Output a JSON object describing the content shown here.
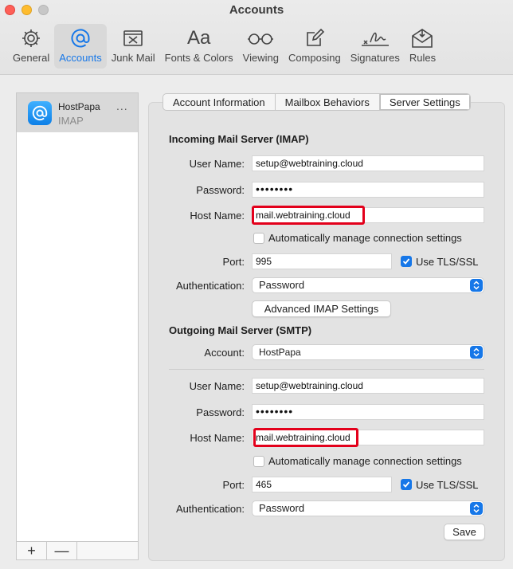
{
  "window": {
    "title": "Accounts"
  },
  "toolbar": {
    "items": [
      {
        "label": "General",
        "icon": "gear-icon"
      },
      {
        "label": "Accounts",
        "icon": "at-icon"
      },
      {
        "label": "Junk Mail",
        "icon": "junk-tray-icon"
      },
      {
        "label": "Fonts & Colors",
        "icon": "fonts-icon"
      },
      {
        "label": "Viewing",
        "icon": "glasses-icon"
      },
      {
        "label": "Composing",
        "icon": "compose-icon"
      },
      {
        "label": "Signatures",
        "icon": "signature-icon"
      },
      {
        "label": "Rules",
        "icon": "rules-envelope-icon"
      }
    ],
    "selected": "Accounts",
    "fonts_glyph": "Aa"
  },
  "accounts": {
    "items": [
      {
        "name": "HostPapa",
        "type": "IMAP",
        "more": "..."
      }
    ],
    "add_label": "+",
    "remove_label": "—"
  },
  "tabs": {
    "items": [
      "Account Information",
      "Mailbox Behaviors",
      "Server Settings"
    ],
    "selected": "Server Settings"
  },
  "incoming": {
    "title": "Incoming Mail Server (IMAP)",
    "username_label": "User Name:",
    "username": "setup@webtraining.cloud",
    "password_label": "Password:",
    "password": "••••••••",
    "hostname_label": "Host Name:",
    "hostname": "mail.webtraining.cloud",
    "auto_manage_label": "Automatically manage connection settings",
    "auto_manage": false,
    "port_label": "Port:",
    "port": "995",
    "tls_label": "Use TLS/SSL",
    "tls": true,
    "auth_label": "Authentication:",
    "auth": "Password",
    "advanced_button": "Advanced IMAP Settings"
  },
  "outgoing": {
    "title": "Outgoing Mail Server (SMTP)",
    "account_label": "Account:",
    "account": "HostPapa",
    "username_label": "User Name:",
    "username": "setup@webtraining.cloud",
    "password_label": "Password:",
    "password": "••••••••",
    "hostname_label": "Host Name:",
    "hostname": "mail.webtraining.cloud",
    "auto_manage_label": "Automatically manage connection settings",
    "auto_manage": false,
    "port_label": "Port:",
    "port": "465",
    "tls_label": "Use TLS/SSL",
    "tls": true,
    "auth_label": "Authentication:",
    "auth": "Password"
  },
  "save_button": "Save",
  "colors": {
    "accent": "#1677e8",
    "highlight": "#e3001b"
  }
}
